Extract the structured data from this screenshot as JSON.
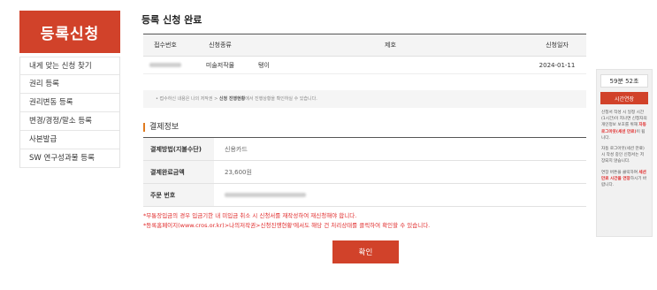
{
  "sidebar": {
    "title": "등록신청",
    "items": [
      {
        "label": "내게 맞는 신청 찾기"
      },
      {
        "label": "권리 등록"
      },
      {
        "label": "권리변동 등록"
      },
      {
        "label": "변경/경정/말소 등록"
      },
      {
        "label": "사본발급"
      },
      {
        "label": "SW 연구성과물 등록"
      }
    ]
  },
  "main": {
    "title": "등록 신청 완료",
    "table": {
      "headers": [
        "접수번호",
        "신청종류",
        "제호",
        "신청일자"
      ],
      "rows": [
        {
          "type": "미술저작물",
          "title": "탱이",
          "date": "2024-01-11"
        }
      ]
    },
    "notice": {
      "prefix": "• 접수하신 내용은 나의 저작권 > ",
      "bold": "신청 진행현황",
      "suffix": "에서 진행상황을 확인하실 수 있습니다."
    },
    "payment": {
      "section_title": "결제정보",
      "rows": [
        {
          "label": "결제방법(지불수단)",
          "value": "신용카드"
        },
        {
          "label": "결제완료금액",
          "value": "23,600원"
        },
        {
          "label": "주문 번호",
          "value": ""
        }
      ]
    },
    "warnings": [
      "*무통장입금의 경우 입금기한 내 미입금 취소 시 신청서를 재작성하여 재신청해야 합니다.",
      "*등록홈페이지(www.cros.or.kr)>나의저작권>신청진행현황'에서도 해당 건 처리상태를 클릭하여 확인할 수 있습니다."
    ],
    "confirm_label": "확인"
  },
  "timer": {
    "time": "59분 52초",
    "extend_label": "시간연장",
    "note1_a": "신청서 작성 시 일정 시간(1시간)이 지나면 신청자의 개인정보 보호를 위해 ",
    "note1_red": "자동 로그아웃(세션 만료)",
    "note1_b": "이 됩니다.",
    "note2": "자동 로그아웃(세션 만료)시 작성 중인 신청서는 저장되지 않습니다.",
    "note3_a": "연장 버튼을 클릭하여 ",
    "note3_red": "세션 만료 시간을 연장",
    "note3_b": "하시기 바랍니다."
  },
  "colors": {
    "accent": "#d1422a",
    "warning": "#e02b2b",
    "section_bar": "#e07a1f"
  }
}
